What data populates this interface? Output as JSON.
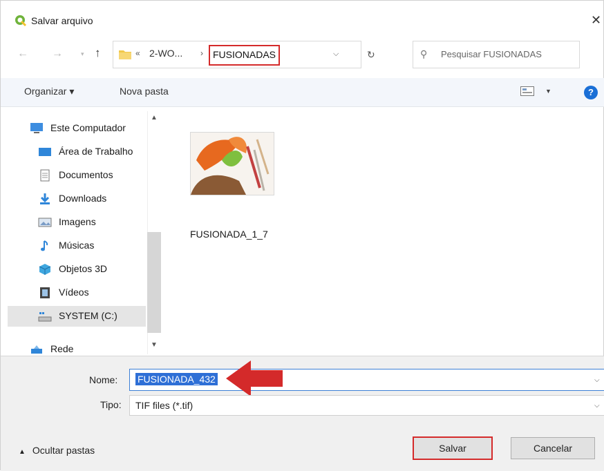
{
  "window": {
    "title": "Salvar arquivo",
    "close_glyph": "✕"
  },
  "address": {
    "crumb_prefix": "«",
    "crumb_parent": "2-WO...",
    "crumb_separator": "›",
    "current_folder": "FUSIONADAS",
    "search_placeholder": "Pesquisar FUSIONADAS"
  },
  "toolbar": {
    "organize_label": "Organizar ▾",
    "new_folder_label": "Nova pasta",
    "help_glyph": "?"
  },
  "nav_pane": {
    "items": [
      {
        "label": "Este Computador",
        "icon": "computer-icon"
      },
      {
        "label": "Área de Trabalho",
        "icon": "desktop-icon"
      },
      {
        "label": "Documentos",
        "icon": "documents-icon"
      },
      {
        "label": "Downloads",
        "icon": "downloads-icon"
      },
      {
        "label": "Imagens",
        "icon": "pictures-icon"
      },
      {
        "label": "Músicas",
        "icon": "music-icon"
      },
      {
        "label": "Objetos 3D",
        "icon": "3d-objects-icon"
      },
      {
        "label": "Vídeos",
        "icon": "videos-icon"
      },
      {
        "label": "SYSTEM (C:)",
        "icon": "drive-icon",
        "selected": true
      },
      {
        "label": "Rede",
        "icon": "network-icon"
      }
    ]
  },
  "files": [
    {
      "name": "FUSIONADA_1_7",
      "icon": "image-thumbnail"
    }
  ],
  "form": {
    "name_label": "Nome:",
    "name_value": "FUSIONADA_432",
    "type_label": "Tipo:",
    "type_value": "TIF files (*.tif)"
  },
  "footer": {
    "hide_folders_label": "Ocultar pastas",
    "save_label": "Salvar",
    "cancel_label": "Cancelar"
  },
  "colors": {
    "highlight_red": "#d42a2a",
    "selection_blue": "#2e6fd6",
    "toolbar_bg": "#f3f6fb",
    "footer_bg": "#f0f0f0"
  }
}
